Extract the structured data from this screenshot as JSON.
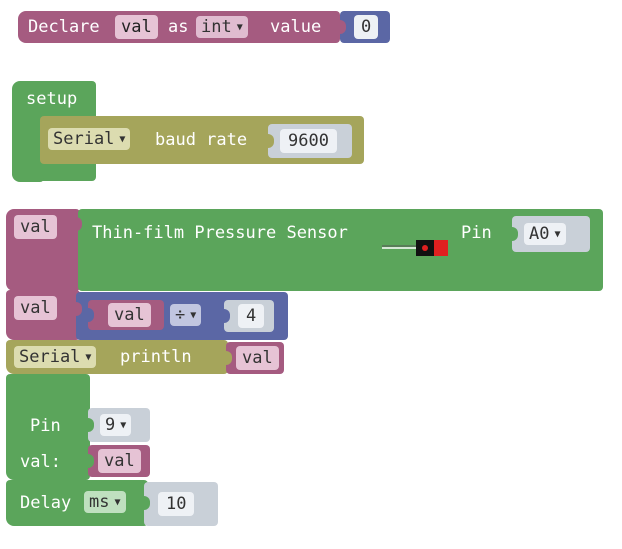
{
  "declare_block": {
    "declare_label": "Declare",
    "var_name": "val",
    "as_label": "as",
    "type": "int",
    "value_label": "value",
    "value": "0"
  },
  "setup_block": {
    "label": "setup",
    "serial_dropdown": "Serial",
    "baud_label": "baud rate",
    "baud_value": "9600"
  },
  "sensor_block": {
    "var_name": "val",
    "sensor_label": "Thin-film Pressure Sensor",
    "pin_label": "Pin",
    "pin_value": "A0"
  },
  "divide_block": {
    "var_name": "val",
    "operand_var": "val",
    "operator": "÷",
    "divisor": "4"
  },
  "println_block": {
    "serial_dropdown": "Serial",
    "println_label": "println",
    "var_name": "val"
  },
  "pin_block": {
    "pin_label": "Pin",
    "pin_value": "9",
    "val_label": "val:",
    "var_name": "val"
  },
  "delay_block": {
    "delay_label": "Delay",
    "unit": "ms",
    "value": "10"
  },
  "colors": {
    "variables": "#a55b80",
    "logic_green": "#5ba55b",
    "serial_olive": "#a5a55b",
    "math_indigo": "#5b67a5"
  }
}
